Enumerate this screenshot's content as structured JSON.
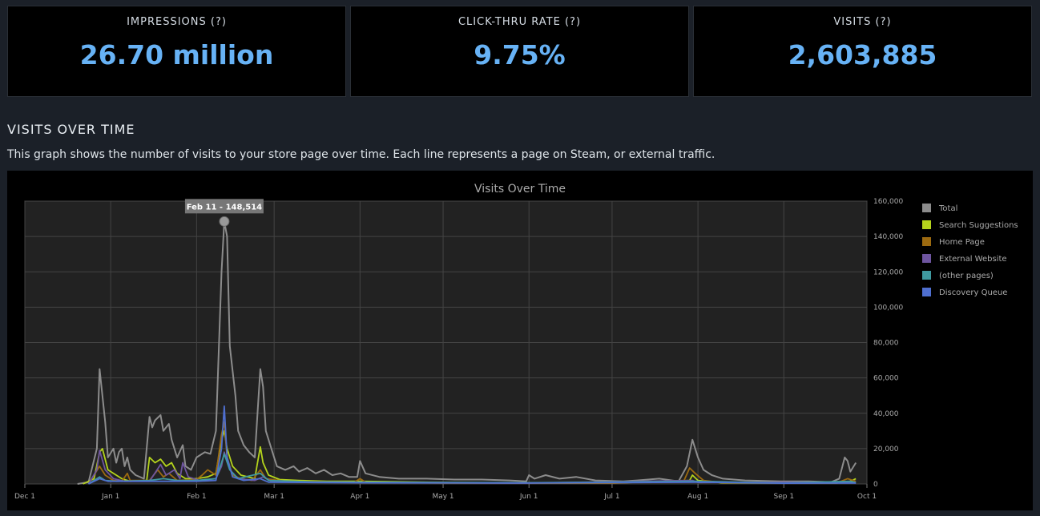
{
  "stats": [
    {
      "label": "IMPRESSIONS",
      "help": "(?)",
      "value": "26.70 million"
    },
    {
      "label": "CLICK-THRU RATE",
      "help": "(?)",
      "value": "9.75%"
    },
    {
      "label": "VISITS",
      "help": "(?)",
      "value": "2,603,885"
    }
  ],
  "section": {
    "title": "VISITS OVER TIME",
    "description": "This graph shows the number of visits to your store page over time. Each line represents a page on Steam, or external traffic."
  },
  "tooltip": {
    "text": "Feb 11 - 148,514",
    "date": "Feb 11",
    "value": 148514
  },
  "colors": {
    "total": "#8c8c8c",
    "search": "#b5d41c",
    "home": "#9c6a10",
    "external": "#6e55a0",
    "other": "#3f9aa0",
    "discovery": "#4f6fd0",
    "grid": "#444444",
    "plot_bg": "#222222"
  },
  "chart_data": {
    "type": "line",
    "title": "Visits Over Time",
    "x_ticks": [
      "Dec 1",
      "Jan 1",
      "Feb 1",
      "Mar 1",
      "Apr 1",
      "May 1",
      "Jun 1",
      "Jul 1",
      "Aug 1",
      "Sep 1",
      "Oct 1"
    ],
    "y_ticks": [
      "160,000",
      "140,000",
      "120,000",
      "100,000",
      "80,000",
      "60,000",
      "40,000",
      "20,000",
      "0"
    ],
    "ylim": [
      0,
      160000
    ],
    "xlim": [
      "Dec 1",
      "Oct 1"
    ],
    "legend_position": "right",
    "grid": true,
    "series": [
      {
        "name": "Total",
        "key": "total",
        "points": [
          [
            "Dec 20",
            0
          ],
          [
            "Dec 24",
            1000
          ],
          [
            "Dec 27",
            20000
          ],
          [
            "Dec 28",
            65000
          ],
          [
            "Dec 30",
            35000
          ],
          [
            "Dec 31",
            15000
          ],
          [
            "Jan 2",
            20000
          ],
          [
            "Jan 3",
            12000
          ],
          [
            "Jan 4",
            18000
          ],
          [
            "Jan 5",
            20000
          ],
          [
            "Jan 6",
            10000
          ],
          [
            "Jan 7",
            15000
          ],
          [
            "Jan 8",
            8000
          ],
          [
            "Jan 10",
            5000
          ],
          [
            "Jan 13",
            3000
          ],
          [
            "Jan 15",
            38000
          ],
          [
            "Jan 16",
            32000
          ],
          [
            "Jan 17",
            36000
          ],
          [
            "Jan 19",
            39000
          ],
          [
            "Jan 20",
            30000
          ],
          [
            "Jan 22",
            34000
          ],
          [
            "Jan 23",
            25000
          ],
          [
            "Jan 25",
            15000
          ],
          [
            "Jan 27",
            22000
          ],
          [
            "Jan 28",
            10000
          ],
          [
            "Jan 30",
            8000
          ],
          [
            "Feb 1",
            15000
          ],
          [
            "Feb 4",
            18000
          ],
          [
            "Feb 6",
            17000
          ],
          [
            "Feb 8",
            30000
          ],
          [
            "Feb 10",
            120000
          ],
          [
            "Feb 11",
            148514
          ],
          [
            "Feb 12",
            140000
          ],
          [
            "Feb 13",
            78000
          ],
          [
            "Feb 15",
            50000
          ],
          [
            "Feb 16",
            30000
          ],
          [
            "Feb 18",
            22000
          ],
          [
            "Feb 20",
            18000
          ],
          [
            "Feb 22",
            15000
          ],
          [
            "Feb 23",
            40000
          ],
          [
            "Feb 24",
            65000
          ],
          [
            "Feb 25",
            55000
          ],
          [
            "Feb 26",
            30000
          ],
          [
            "Feb 28",
            20000
          ],
          [
            "Mar 2",
            10000
          ],
          [
            "Mar 5",
            8000
          ],
          [
            "Mar 8",
            10000
          ],
          [
            "Mar 10",
            7000
          ],
          [
            "Mar 13",
            9000
          ],
          [
            "Mar 16",
            6000
          ],
          [
            "Mar 19",
            8000
          ],
          [
            "Mar 22",
            5000
          ],
          [
            "Mar 25",
            6000
          ],
          [
            "Mar 28",
            4000
          ],
          [
            "Mar 31",
            4000
          ],
          [
            "Apr 1",
            13000
          ],
          [
            "Apr 3",
            6000
          ],
          [
            "Apr 8",
            4000
          ],
          [
            "Apr 15",
            3000
          ],
          [
            "Apr 25",
            3000
          ],
          [
            "May 5",
            2500
          ],
          [
            "May 15",
            2500
          ],
          [
            "May 25",
            2000
          ],
          [
            "May 31",
            1500
          ],
          [
            "Jun 1",
            5000
          ],
          [
            "Jun 3",
            3000
          ],
          [
            "Jun 7",
            5000
          ],
          [
            "Jun 12",
            3000
          ],
          [
            "Jun 18",
            4000
          ],
          [
            "Jun 25",
            2000
          ],
          [
            "Jul 5",
            1500
          ],
          [
            "Jul 10",
            2000
          ],
          [
            "Jul 18",
            3000
          ],
          [
            "Jul 25",
            1500
          ],
          [
            "Jul 28",
            10000
          ],
          [
            "Jul 30",
            25000
          ],
          [
            "Aug 1",
            15000
          ],
          [
            "Aug 3",
            8000
          ],
          [
            "Aug 6",
            5000
          ],
          [
            "Aug 10",
            3000
          ],
          [
            "Aug 18",
            2000
          ],
          [
            "Aug 31",
            1500
          ],
          [
            "Sep 10",
            1500
          ],
          [
            "Sep 18",
            1000
          ],
          [
            "Sep 21",
            3000
          ],
          [
            "Sep 23",
            15000
          ],
          [
            "Sep 24",
            13000
          ],
          [
            "Sep 25",
            7000
          ],
          [
            "Sep 27",
            12000
          ]
        ]
      },
      {
        "name": "Search Suggestions",
        "key": "search",
        "points": [
          [
            "Dec 22",
            0
          ],
          [
            "Dec 26",
            3000
          ],
          [
            "Dec 28",
            18000
          ],
          [
            "Dec 29",
            20000
          ],
          [
            "Dec 31",
            8000
          ],
          [
            "Jan 3",
            5000
          ],
          [
            "Jan 5",
            3000
          ],
          [
            "Jan 8",
            1500
          ],
          [
            "Jan 14",
            2000
          ],
          [
            "Jan 15",
            15000
          ],
          [
            "Jan 17",
            12000
          ],
          [
            "Jan 19",
            14000
          ],
          [
            "Jan 21",
            10000
          ],
          [
            "Jan 23",
            12000
          ],
          [
            "Jan 25",
            6000
          ],
          [
            "Jan 28",
            3000
          ],
          [
            "Feb 1",
            3000
          ],
          [
            "Feb 5",
            4000
          ],
          [
            "Feb 8",
            6000
          ],
          [
            "Feb 10",
            25000
          ],
          [
            "Feb 11",
            30000
          ],
          [
            "Feb 12",
            20000
          ],
          [
            "Feb 14",
            10000
          ],
          [
            "Feb 17",
            5000
          ],
          [
            "Feb 22",
            3000
          ],
          [
            "Feb 23",
            12000
          ],
          [
            "Feb 24",
            21000
          ],
          [
            "Feb 25",
            12000
          ],
          [
            "Feb 27",
            5000
          ],
          [
            "Mar 3",
            2500
          ],
          [
            "Mar 10",
            2000
          ],
          [
            "Mar 20",
            1500
          ],
          [
            "Apr 1",
            1500
          ],
          [
            "May 1",
            800
          ],
          [
            "Jun 1",
            600
          ],
          [
            "Jul 1",
            500
          ],
          [
            "Jul 29",
            2000
          ],
          [
            "Jul 30",
            5000
          ],
          [
            "Aug 1",
            2000
          ],
          [
            "Aug 10",
            600
          ],
          [
            "Sep 20",
            500
          ],
          [
            "Sep 25",
            1500
          ],
          [
            "Sep 27",
            3000
          ]
        ]
      },
      {
        "name": "Home Page",
        "key": "home",
        "points": [
          [
            "Dec 24",
            0
          ],
          [
            "Dec 28",
            10000
          ],
          [
            "Dec 30",
            5000
          ],
          [
            "Jan 2",
            2000
          ],
          [
            "Jan 5",
            1500
          ],
          [
            "Jan 7",
            6000
          ],
          [
            "Jan 8",
            2000
          ],
          [
            "Jan 15",
            2000
          ],
          [
            "Jan 18",
            8000
          ],
          [
            "Jan 20",
            4000
          ],
          [
            "Jan 22",
            6000
          ],
          [
            "Jan 25",
            2000
          ],
          [
            "Feb 1",
            2500
          ],
          [
            "Feb 3",
            5000
          ],
          [
            "Feb 5",
            8000
          ],
          [
            "Feb 8",
            5000
          ],
          [
            "Feb 10",
            28000
          ],
          [
            "Feb 11",
            35000
          ],
          [
            "Feb 12",
            15000
          ],
          [
            "Feb 14",
            5000
          ],
          [
            "Feb 17",
            3000
          ],
          [
            "Feb 21",
            2000
          ],
          [
            "Feb 24",
            8000
          ],
          [
            "Feb 26",
            3000
          ],
          [
            "Mar 5",
            1500
          ],
          [
            "Mar 30",
            1000
          ],
          [
            "Apr 1",
            3000
          ],
          [
            "Apr 3",
            1000
          ],
          [
            "May 1",
            500
          ],
          [
            "Jul 1",
            400
          ],
          [
            "Jul 27",
            2000
          ],
          [
            "Jul 29",
            9000
          ],
          [
            "Jul 31",
            6000
          ],
          [
            "Aug 3",
            2000
          ],
          [
            "Aug 10",
            700
          ],
          [
            "Sep 20",
            500
          ],
          [
            "Sep 24",
            3000
          ],
          [
            "Sep 27",
            1500
          ]
        ]
      },
      {
        "name": "External Website",
        "key": "external",
        "points": [
          [
            "Dec 24",
            0
          ],
          [
            "Dec 27",
            8000
          ],
          [
            "Dec 28",
            19000
          ],
          [
            "Dec 30",
            8000
          ],
          [
            "Jan 2",
            3000
          ],
          [
            "Jan 6",
            1500
          ],
          [
            "Jan 15",
            1500
          ],
          [
            "Jan 19",
            11000
          ],
          [
            "Jan 21",
            5000
          ],
          [
            "Jan 24",
            8000
          ],
          [
            "Jan 26",
            3000
          ],
          [
            "Jan 27",
            12000
          ],
          [
            "Jan 29",
            4000
          ],
          [
            "Feb 2",
            2000
          ],
          [
            "Feb 8",
            3000
          ],
          [
            "Feb 10",
            10000
          ],
          [
            "Feb 11",
            18000
          ],
          [
            "Feb 13",
            8000
          ],
          [
            "Feb 16",
            3000
          ],
          [
            "Feb 22",
            2000
          ],
          [
            "Feb 25",
            4000
          ],
          [
            "Feb 28",
            1500
          ],
          [
            "Mar 15",
            1000
          ],
          [
            "Apr 1",
            800
          ],
          [
            "Jun 1",
            500
          ],
          [
            "Jul 30",
            2000
          ],
          [
            "Aug 1",
            800
          ],
          [
            "Sep 24",
            1000
          ],
          [
            "Sep 27",
            500
          ]
        ]
      },
      {
        "name": "(other pages)",
        "key": "other",
        "points": [
          [
            "Dec 24",
            0
          ],
          [
            "Dec 28",
            4000
          ],
          [
            "Dec 30",
            2000
          ],
          [
            "Jan 3",
            1500
          ],
          [
            "Jan 15",
            2000
          ],
          [
            "Jan 20",
            3000
          ],
          [
            "Jan 25",
            2000
          ],
          [
            "Feb 1",
            2000
          ],
          [
            "Feb 8",
            3000
          ],
          [
            "Feb 10",
            12000
          ],
          [
            "Feb 11",
            17000
          ],
          [
            "Feb 13",
            8000
          ],
          [
            "Feb 16",
            3000
          ],
          [
            "Feb 24",
            6000
          ],
          [
            "Feb 27",
            2000
          ],
          [
            "Mar 15",
            1200
          ],
          [
            "Apr 1",
            1000
          ],
          [
            "Jun 1",
            700
          ],
          [
            "Aug 1",
            1500
          ],
          [
            "Sep 1",
            500
          ],
          [
            "Sep 25",
            1500
          ],
          [
            "Sep 27",
            800
          ]
        ]
      },
      {
        "name": "Discovery Queue",
        "key": "discovery",
        "points": [
          [
            "Dec 24",
            0
          ],
          [
            "Dec 28",
            3000
          ],
          [
            "Dec 31",
            1500
          ],
          [
            "Jan 15",
            1500
          ],
          [
            "Feb 1",
            1500
          ],
          [
            "Feb 8",
            2000
          ],
          [
            "Feb 10",
            20000
          ],
          [
            "Feb 11",
            44000
          ],
          [
            "Feb 12",
            15000
          ],
          [
            "Feb 14",
            4000
          ],
          [
            "Feb 18",
            2000
          ],
          [
            "Feb 24",
            3000
          ],
          [
            "Feb 27",
            1000
          ],
          [
            "Mar 15",
            800
          ],
          [
            "Apr 1",
            700
          ],
          [
            "Jun 1",
            500
          ],
          [
            "Aug 1",
            1000
          ],
          [
            "Sep 1",
            400
          ],
          [
            "Sep 27",
            500
          ]
        ]
      }
    ]
  }
}
